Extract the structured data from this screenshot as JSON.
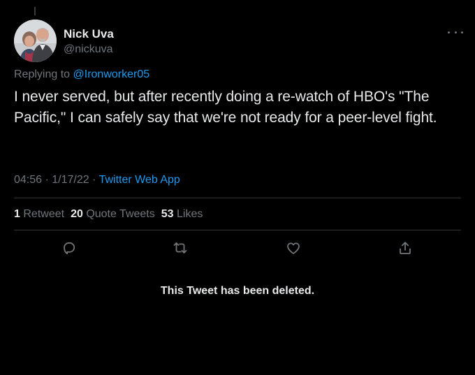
{
  "author": {
    "display_name": "Nick Uva",
    "handle": "@nickuva"
  },
  "reply": {
    "prefix": "Replying to",
    "mention": "@Ironworker05"
  },
  "tweet": {
    "text": "I never served, but after recently doing a re-watch of HBO's \"The Pacific,\" I can safely say that we're not ready for a peer-level fight.",
    "time": "04:56",
    "separator": "·",
    "date": "1/17/22",
    "source": "Twitter Web App"
  },
  "stats": {
    "retweets_count": "1",
    "retweets_label": "Retweet",
    "quotes_count": "20",
    "quotes_label": "Quote Tweets",
    "likes_count": "53",
    "likes_label": "Likes"
  },
  "icons": {
    "reply": "reply-icon",
    "retweet": "retweet-icon",
    "like": "like-icon",
    "share": "share-icon",
    "more": "more-icon"
  },
  "colors": {
    "background": "#000000",
    "text": "#e7e9ea",
    "secondary": "#71767b",
    "accent": "#1d9bf0",
    "divider": "#2f3336"
  },
  "quoted": {
    "deleted_notice": "This Tweet has been deleted."
  }
}
